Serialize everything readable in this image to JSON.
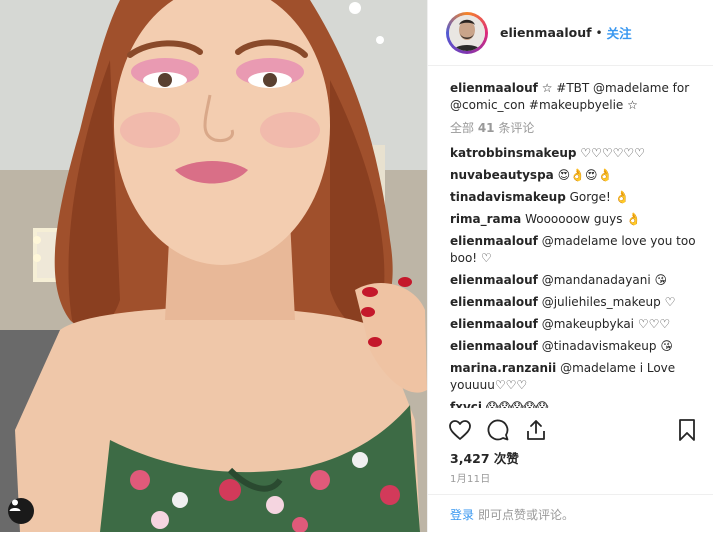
{
  "post": {
    "username": "elienmaalouf",
    "separator": "•",
    "follow_label": "关注",
    "caption_user": "elienmaalouf",
    "caption_text": "☆ #TBT @madelame for @comic_con #makeupbyelie ☆",
    "view_all_prefix": "全部 ",
    "view_all_count": "41",
    "view_all_suffix": " 条评论",
    "comments": [
      {
        "user": "katrobbinsmakeup",
        "text": "♡♡♡♡♡♡"
      },
      {
        "user": "nuvabeautyspa",
        "text": "😍👌😍👌"
      },
      {
        "user": "tinadavismakeup",
        "text": "Gorge! 👌"
      },
      {
        "user": "rima_rama",
        "text": "Woooooow guys 👌"
      },
      {
        "user": "elienmaalouf",
        "text": "@madelame love you too boo! ♡"
      },
      {
        "user": "elienmaalouf",
        "text": "@mandanadayani 😘"
      },
      {
        "user": "elienmaalouf",
        "text": "@juliehiles_makeup ♡"
      },
      {
        "user": "elienmaalouf",
        "text": "@makeupbykai ♡♡♡"
      },
      {
        "user": "elienmaalouf",
        "text": "@tinadavismakeup 😘"
      },
      {
        "user": "marina.ranzanii",
        "text": "@madelame i Love youuuu♡♡♡"
      },
      {
        "user": "fxvci",
        "text": "😱😱😱😱😱"
      }
    ],
    "likes_count": "3,427",
    "likes_suffix": " 次赞",
    "date": "1月11日"
  },
  "footer": {
    "login_label": "登录",
    "rest_label": "即可点赞或评论。"
  },
  "icons": {
    "like": "heart-icon",
    "comment": "comment-icon",
    "share": "share-icon",
    "save": "bookmark-icon",
    "user_tag": "user-tag-icon"
  },
  "colors": {
    "accent": "#3897f0",
    "text": "#262626",
    "muted": "#999999",
    "border": "#efefef"
  }
}
